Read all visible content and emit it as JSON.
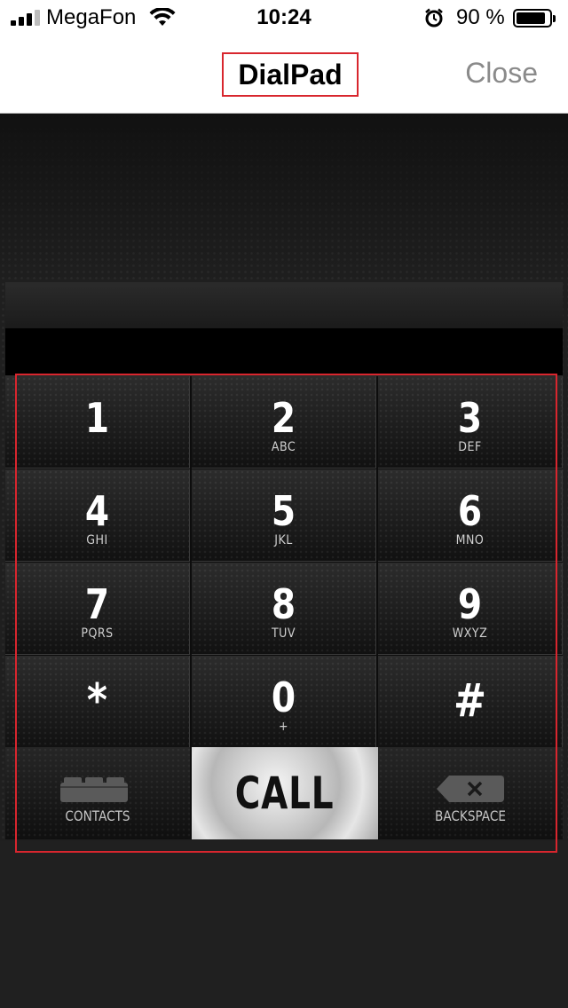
{
  "status_bar": {
    "carrier": "MegaFon",
    "time": "10:24",
    "battery_percent": "90 %",
    "signal_bars": 3,
    "icons": [
      "signal-icon",
      "wifi-icon",
      "alarm-icon",
      "battery-icon"
    ]
  },
  "nav": {
    "title": "DialPad",
    "close_label": "Close"
  },
  "display": {
    "number": ""
  },
  "keypad": {
    "keys": [
      {
        "digit": "1",
        "letters": ""
      },
      {
        "digit": "2",
        "letters": "ABC"
      },
      {
        "digit": "3",
        "letters": "DEF"
      },
      {
        "digit": "4",
        "letters": "GHI"
      },
      {
        "digit": "5",
        "letters": "JKL"
      },
      {
        "digit": "6",
        "letters": "MNO"
      },
      {
        "digit": "7",
        "letters": "PQRS"
      },
      {
        "digit": "8",
        "letters": "TUV"
      },
      {
        "digit": "9",
        "letters": "WXYZ"
      },
      {
        "digit": "*",
        "letters": ""
      },
      {
        "digit": "0",
        "letters": "+"
      },
      {
        "digit": "#",
        "letters": ""
      }
    ],
    "contacts_label": "CONTACTS",
    "call_label": "CALL",
    "backspace_label": "BACKSPACE"
  },
  "colors": {
    "highlight": "#d8262e",
    "close_text": "#8a8a8a",
    "pad_background": "#1f1f1f"
  }
}
